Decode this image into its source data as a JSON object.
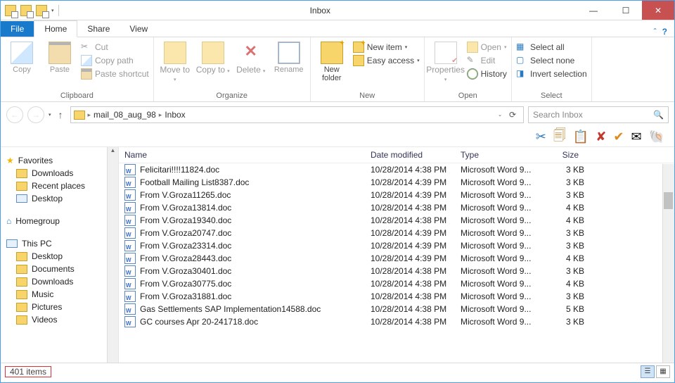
{
  "window": {
    "title": "Inbox"
  },
  "tabs": {
    "file": "File",
    "home": "Home",
    "share": "Share",
    "view": "View"
  },
  "ribbon": {
    "clipboard": {
      "label": "Clipboard",
      "copy": "Copy",
      "paste": "Paste",
      "cut": "Cut",
      "copy_path": "Copy path",
      "paste_shortcut": "Paste shortcut"
    },
    "organize": {
      "label": "Organize",
      "move_to": "Move to",
      "copy_to": "Copy to",
      "delete": "Delete",
      "rename": "Rename"
    },
    "new": {
      "label": "New",
      "new_folder": "New folder",
      "new_item": "New item",
      "easy_access": "Easy access"
    },
    "open": {
      "label": "Open",
      "properties": "Properties",
      "open": "Open",
      "edit": "Edit",
      "history": "History"
    },
    "select": {
      "label": "Select",
      "select_all": "Select all",
      "select_none": "Select none",
      "invert": "Invert selection"
    }
  },
  "breadcrumb": {
    "seg1": "mail_08_aug_98",
    "seg2": "Inbox"
  },
  "search": {
    "placeholder": "Search Inbox"
  },
  "nav": {
    "favorites": "Favorites",
    "downloads": "Downloads",
    "recent": "Recent places",
    "desktop": "Desktop",
    "homegroup": "Homegroup",
    "thispc": "This PC",
    "pc_desktop": "Desktop",
    "pc_documents": "Documents",
    "pc_downloads": "Downloads",
    "pc_music": "Music",
    "pc_pictures": "Pictures",
    "pc_videos": "Videos"
  },
  "columns": {
    "name": "Name",
    "date": "Date modified",
    "type": "Type",
    "size": "Size"
  },
  "files": [
    {
      "name": "Felicitari!!!!11824.doc",
      "date": "10/28/2014 4:38 PM",
      "type": "Microsoft Word 9...",
      "size": "3 KB"
    },
    {
      "name": "Football Mailing List8387.doc",
      "date": "10/28/2014 4:39 PM",
      "type": "Microsoft Word 9...",
      "size": "3 KB"
    },
    {
      "name": "From V.Groza11265.doc",
      "date": "10/28/2014 4:39 PM",
      "type": "Microsoft Word 9...",
      "size": "3 KB"
    },
    {
      "name": "From V.Groza13814.doc",
      "date": "10/28/2014 4:38 PM",
      "type": "Microsoft Word 9...",
      "size": "4 KB"
    },
    {
      "name": "From V.Groza19340.doc",
      "date": "10/28/2014 4:38 PM",
      "type": "Microsoft Word 9...",
      "size": "4 KB"
    },
    {
      "name": "From V.Groza20747.doc",
      "date": "10/28/2014 4:39 PM",
      "type": "Microsoft Word 9...",
      "size": "3 KB"
    },
    {
      "name": "From V.Groza23314.doc",
      "date": "10/28/2014 4:39 PM",
      "type": "Microsoft Word 9...",
      "size": "3 KB"
    },
    {
      "name": "From V.Groza28443.doc",
      "date": "10/28/2014 4:39 PM",
      "type": "Microsoft Word 9...",
      "size": "4 KB"
    },
    {
      "name": "From V.Groza30401.doc",
      "date": "10/28/2014 4:38 PM",
      "type": "Microsoft Word 9...",
      "size": "3 KB"
    },
    {
      "name": "From V.Groza30775.doc",
      "date": "10/28/2014 4:38 PM",
      "type": "Microsoft Word 9...",
      "size": "4 KB"
    },
    {
      "name": "From V.Groza31881.doc",
      "date": "10/28/2014 4:38 PM",
      "type": "Microsoft Word 9...",
      "size": "3 KB"
    },
    {
      "name": "Gas Settlements SAP Implementation14588.doc",
      "date": "10/28/2014 4:38 PM",
      "type": "Microsoft Word 9...",
      "size": "5 KB"
    },
    {
      "name": "GC courses Apr 20-241718.doc",
      "date": "10/28/2014 4:38 PM",
      "type": "Microsoft Word 9...",
      "size": "3 KB"
    }
  ],
  "status": {
    "count": "401 items"
  }
}
